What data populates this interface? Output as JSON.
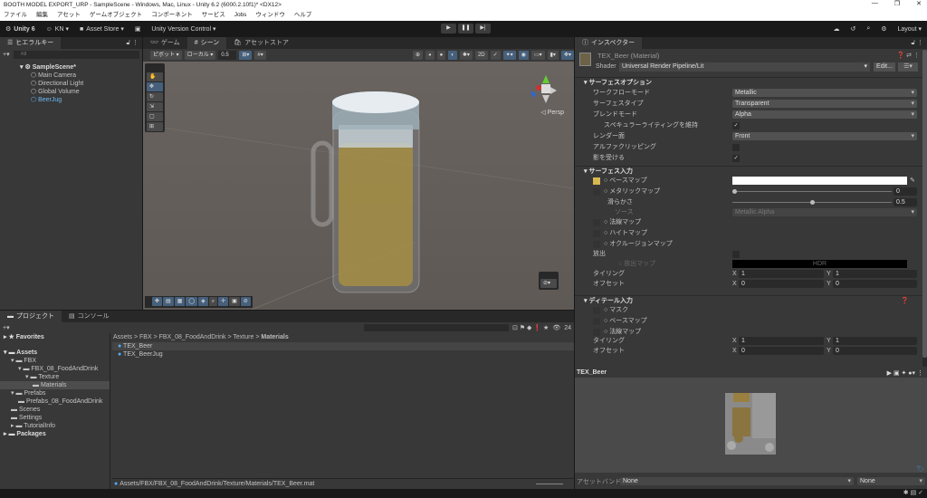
{
  "window": {
    "title": "BOOTH MODEL EXPORT_URP - SampleScene - Windows, Mac, Linux - Unity 6.2 (6000.2.10f1)* <DX12>",
    "minimize": "—",
    "maximize": "❐",
    "close": "✕"
  },
  "menu": [
    "ファイル",
    "編集",
    "アセット",
    "ゲームオブジェクト",
    "コンポーネント",
    "サービス",
    "Jobs",
    "ウィンドウ",
    "ヘルプ"
  ],
  "toolbar": {
    "unity": "Unity 6",
    "account": "KN ▾",
    "asset_store": "Asset Store ▾",
    "version_control": "Unity Version Control ▾",
    "layout": "Layout ▾",
    "play": "▶",
    "pause": "❚❚",
    "step": "▶|"
  },
  "hierarchy": {
    "tab": "ヒエラルキー",
    "search_placeholder": "All",
    "items": [
      {
        "label": "SampleScene*"
      },
      {
        "label": "Main Camera"
      },
      {
        "label": "Directional Light"
      },
      {
        "label": "Global Volume"
      },
      {
        "label": "BeerJug"
      }
    ]
  },
  "scene": {
    "tabs": [
      "ゲーム",
      "シーン",
      "アセットストア"
    ],
    "pivot": "ピボット ▾",
    "local": "ローカル ▾",
    "snap": "0.5",
    "persp": "◁ Persp"
  },
  "inspector": {
    "tab": "インスペクター",
    "material": "TEX_Beer (Material)",
    "shader_label": "Shader",
    "shader": "Universal Render Pipeline/Lit",
    "edit": "Edit...",
    "surface_options": {
      "title": "サーフェスオプション",
      "rows": [
        {
          "label": "ワークフローモード",
          "value": "Metallic"
        },
        {
          "label": "サーフェスタイプ",
          "value": "Transparent"
        },
        {
          "label": "ブレンドモード",
          "value": "Alpha"
        },
        {
          "label": "スペキュラーライティングを維持",
          "checked": true
        },
        {
          "label": "レンダー面",
          "value": "Front"
        },
        {
          "label": "アルファクリッピング",
          "checked": false
        },
        {
          "label": "影を受ける",
          "checked": true
        }
      ]
    },
    "surface_inputs": {
      "title": "サーフェス入力",
      "base_map": "ベースマップ",
      "base_color": "#ffffff",
      "metallic_map": "メタリックマップ",
      "metallic": "0",
      "metallic_value": 0,
      "smoothness": "滑らかさ",
      "smoothness_val": "0.5",
      "smoothness_value": 0.5,
      "source": "ソース",
      "source_value": "Metallic Alpha",
      "normal_map": "法線マップ",
      "height_map": "ハイトマップ",
      "occlusion_map": "オクルージョンマップ",
      "emission": "放出",
      "emission_map": "放出マップ",
      "hdr": "HDR",
      "tiling": "タイリング",
      "offset": "オフセット",
      "tiling_x": "1",
      "tiling_y": "1",
      "offset_x": "0",
      "offset_y": "0"
    },
    "detail_inputs": {
      "title": "ディテール入力",
      "mask": "マスク",
      "base_map": "ベースマップ",
      "normal_map": "法線マップ",
      "tiling": "タイリング",
      "offset": "オフセット",
      "tiling_x": "1",
      "tiling_y": "1",
      "offset_x": "0",
      "offset_y": "0"
    },
    "x": "X",
    "y": "Y",
    "preview_title": "TEX_Beer",
    "asset_bundle_label": "アセットバンドル",
    "asset_bundle": "None",
    "asset_variant": "None"
  },
  "project": {
    "tabs": [
      "プロジェクト",
      "コンソール"
    ],
    "count": "24",
    "tree": [
      {
        "label": "Favorites",
        "indent": 0
      },
      {
        "label": "Assets",
        "indent": 0
      },
      {
        "label": "FBX",
        "indent": 1
      },
      {
        "label": "FBX_08_FoodAndDrink",
        "indent": 2
      },
      {
        "label": "Texture",
        "indent": 3
      },
      {
        "label": "Materials",
        "indent": 4
      },
      {
        "label": "Prefabs",
        "indent": 1
      },
      {
        "label": "Prefabs_08_FoodAndDrink",
        "indent": 2
      },
      {
        "label": "Scenes",
        "indent": 1
      },
      {
        "label": "Settings",
        "indent": 1
      },
      {
        "label": "TutorialInfo",
        "indent": 1
      },
      {
        "label": "Packages",
        "indent": 0
      }
    ],
    "breadcrumb": [
      "Assets",
      "FBX",
      "FBX_08_FoodAndDrink",
      "Texture",
      "Materials"
    ],
    "files": [
      "TEX_Beer",
      "TEX_BeerJug"
    ],
    "path": "Assets/FBX/FBX_08_FoodAndDrink/Texture/Materials/TEX_Beer.mat"
  }
}
